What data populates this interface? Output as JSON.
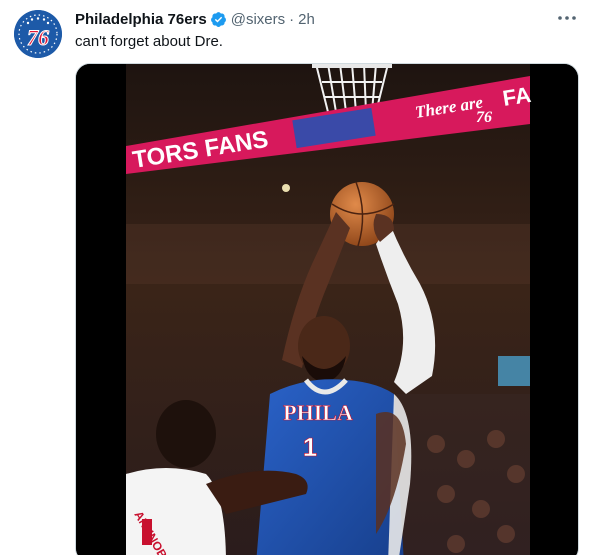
{
  "tweet": {
    "display_name": "Philadelphia 76ers",
    "handle": "@sixers",
    "separator": "·",
    "time": "2h",
    "text": "can't forget about Dre."
  },
  "avatar": {
    "logo_text": "76"
  },
  "media": {
    "banner_left": "TORS FANS",
    "banner_right": "There are",
    "banner_right_letters": "FA",
    "banner_logo": "76",
    "jersey_text": "PHILA",
    "jersey_number": "1",
    "opponent_jersey_text": "ANUNOBY"
  },
  "colors": {
    "verified_blue": "#1d9bf0",
    "sixers_blue": "#1d5aa8",
    "banner_red": "#d7195c",
    "text_primary": "#0f1419",
    "text_secondary": "#536471"
  },
  "icons": {
    "verified": "verified-badge-icon",
    "more": "more-options-icon"
  }
}
